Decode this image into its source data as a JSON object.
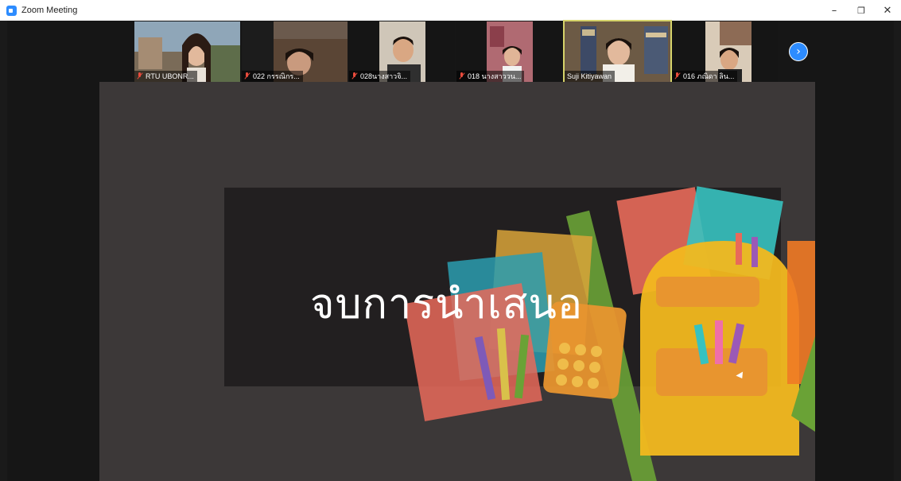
{
  "window": {
    "title": "Zoom Meeting"
  },
  "controls": {
    "minimize": "–",
    "restore": "❐",
    "close": "✕"
  },
  "participants": [
    {
      "name": "RTU UBONR...",
      "muted": true
    },
    {
      "name": "022 กรรณิกร...",
      "muted": true
    },
    {
      "name": "028นางสาวจิ...",
      "muted": true
    },
    {
      "name": "018 นางสาววน...",
      "muted": true
    },
    {
      "name": "Suji Kitiyawan",
      "muted": false
    },
    {
      "name": "016 ภณิดา ลิน...",
      "muted": true
    }
  ],
  "gallery": {
    "next_icon": "›"
  },
  "slide": {
    "title": "จบการนำเสนอ"
  },
  "colors": {
    "accent": "#2d8cff",
    "active_speaker": "#d6d36a",
    "slide_bg": "#3c3838"
  }
}
